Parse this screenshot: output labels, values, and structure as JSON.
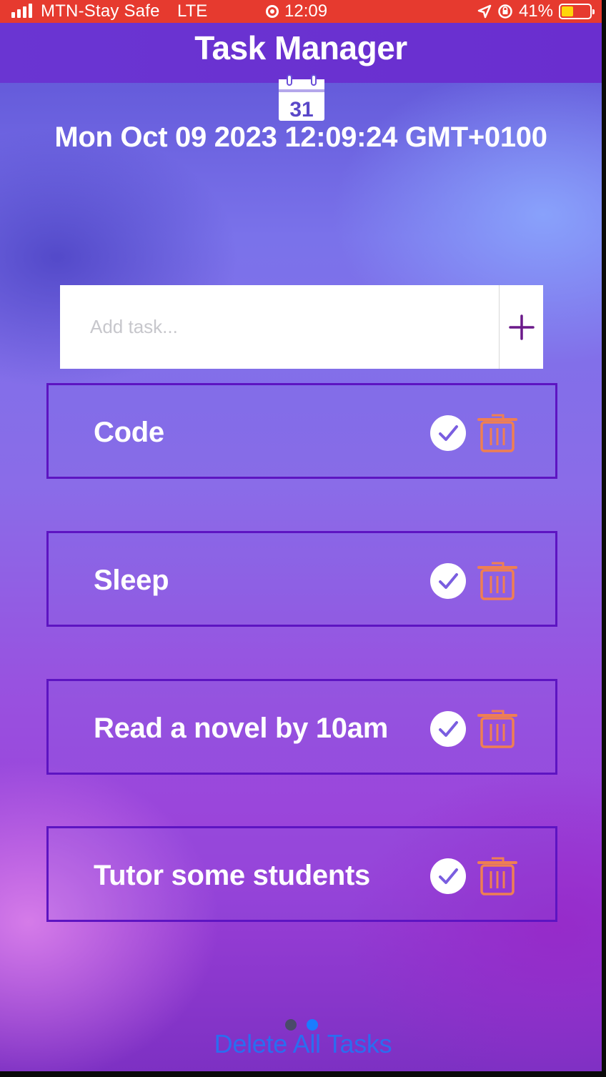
{
  "status_bar": {
    "carrier": "MTN-Stay Safe",
    "network": "LTE",
    "time": "12:09",
    "battery": "41%",
    "battery_level": 0.41
  },
  "header": {
    "title": "Task Manager"
  },
  "calendar": {
    "icon": "calendar-icon",
    "day": "31"
  },
  "date_text": "Mon Oct 09 2023 12:09:24 GMT+0100",
  "input": {
    "placeholder": "Add task...",
    "value": "",
    "add_icon": "plus-icon"
  },
  "tasks": [
    {
      "label": "Code"
    },
    {
      "label": "Sleep"
    },
    {
      "label": "Read a novel by 10am"
    },
    {
      "label": "Tutor some students"
    }
  ],
  "delete_all_label": "Delete All Tasks",
  "colors": {
    "status_bar": "#e63a2f",
    "header": "#6a35d2",
    "card_border": "#5d14c2",
    "trash": "#ef7f52",
    "delete_all": "#2b6df0",
    "add_plus": "#6b1a8a"
  }
}
